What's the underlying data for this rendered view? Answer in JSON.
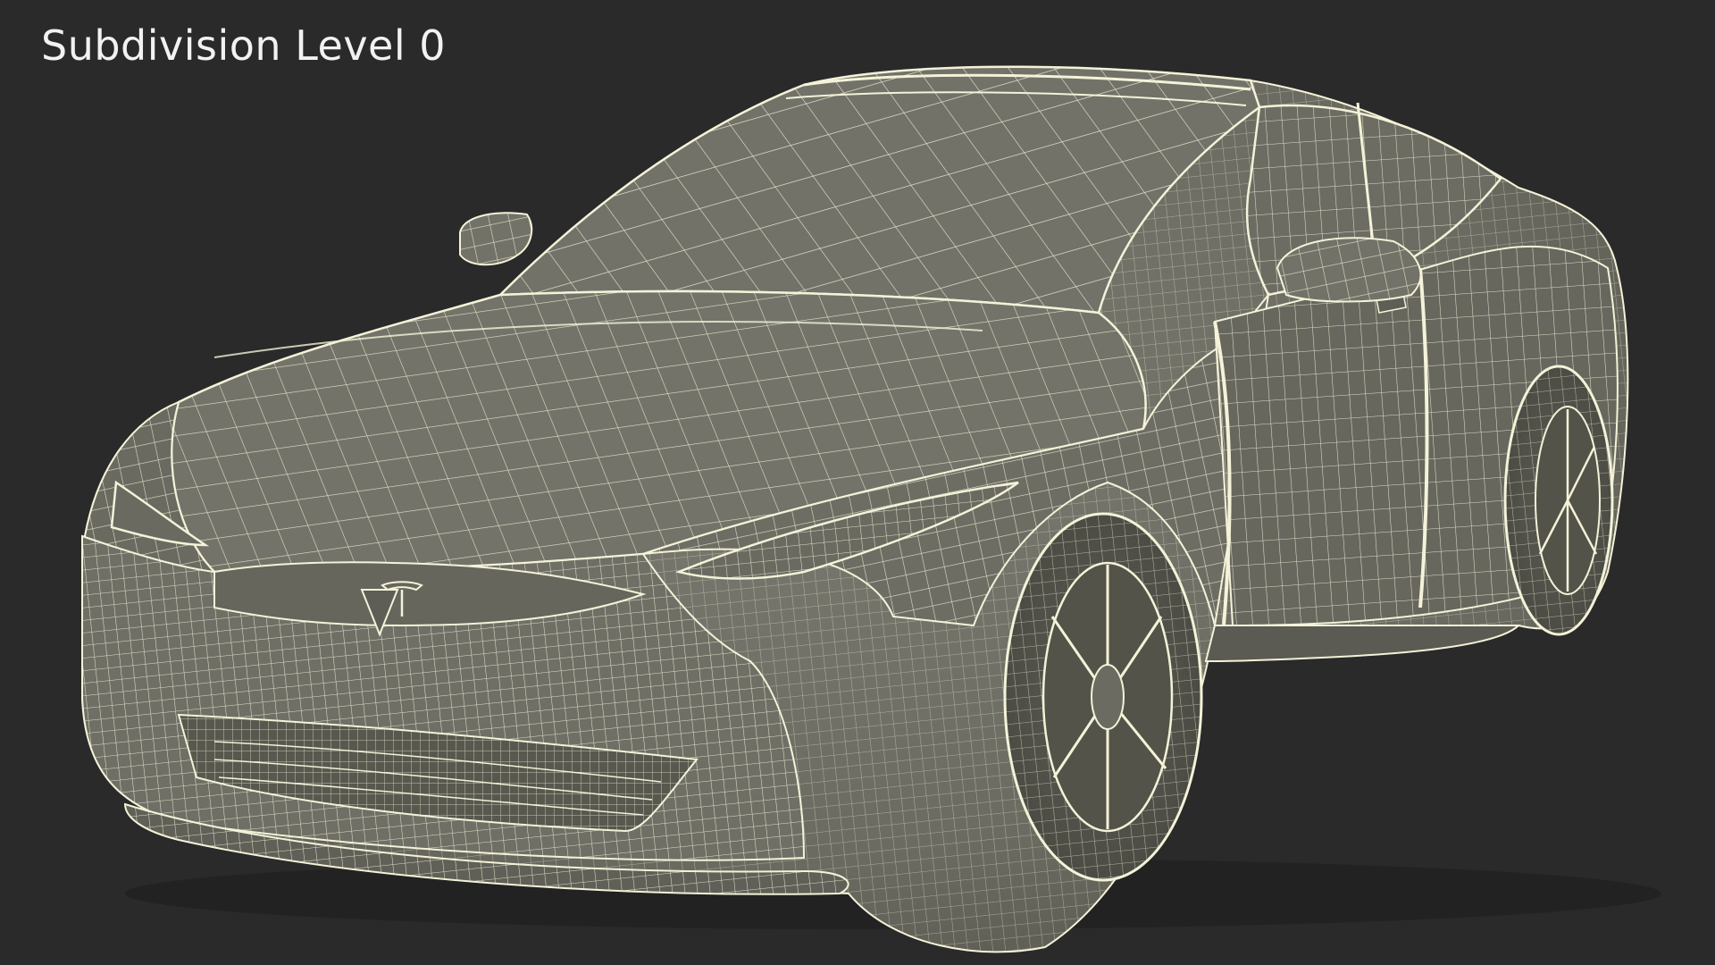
{
  "viewport": {
    "label": "Subdivision Level 0",
    "background_color": "#2a2a2a",
    "body_color": "#6f6f66",
    "wire_color": "#f4f2d8",
    "shadow_color": "#55554d"
  },
  "model": {
    "subject": "tesla-model-s-wireframe",
    "emblem": "tesla-logo-icon"
  }
}
